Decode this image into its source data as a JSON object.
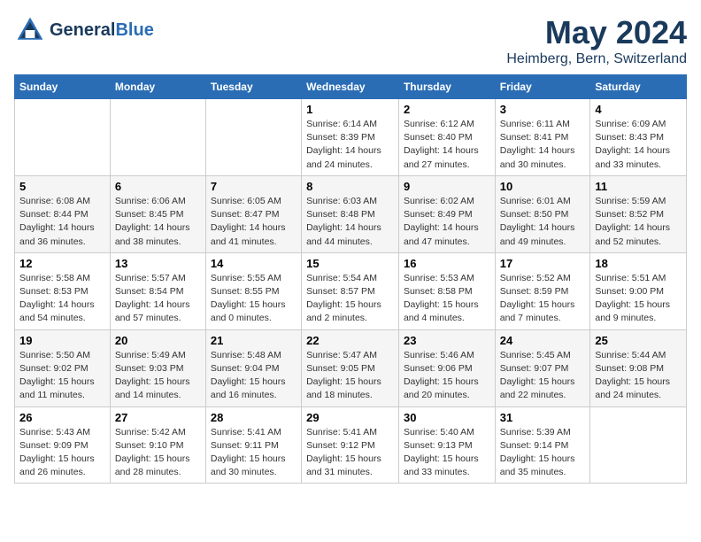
{
  "header": {
    "logo_line1": "General",
    "logo_line2": "Blue",
    "month": "May 2024",
    "location": "Heimberg, Bern, Switzerland"
  },
  "weekdays": [
    "Sunday",
    "Monday",
    "Tuesday",
    "Wednesday",
    "Thursday",
    "Friday",
    "Saturday"
  ],
  "weeks": [
    [
      {
        "day": "",
        "info": ""
      },
      {
        "day": "",
        "info": ""
      },
      {
        "day": "",
        "info": ""
      },
      {
        "day": "1",
        "info": "Sunrise: 6:14 AM\nSunset: 8:39 PM\nDaylight: 14 hours\nand 24 minutes."
      },
      {
        "day": "2",
        "info": "Sunrise: 6:12 AM\nSunset: 8:40 PM\nDaylight: 14 hours\nand 27 minutes."
      },
      {
        "day": "3",
        "info": "Sunrise: 6:11 AM\nSunset: 8:41 PM\nDaylight: 14 hours\nand 30 minutes."
      },
      {
        "day": "4",
        "info": "Sunrise: 6:09 AM\nSunset: 8:43 PM\nDaylight: 14 hours\nand 33 minutes."
      }
    ],
    [
      {
        "day": "5",
        "info": "Sunrise: 6:08 AM\nSunset: 8:44 PM\nDaylight: 14 hours\nand 36 minutes."
      },
      {
        "day": "6",
        "info": "Sunrise: 6:06 AM\nSunset: 8:45 PM\nDaylight: 14 hours\nand 38 minutes."
      },
      {
        "day": "7",
        "info": "Sunrise: 6:05 AM\nSunset: 8:47 PM\nDaylight: 14 hours\nand 41 minutes."
      },
      {
        "day": "8",
        "info": "Sunrise: 6:03 AM\nSunset: 8:48 PM\nDaylight: 14 hours\nand 44 minutes."
      },
      {
        "day": "9",
        "info": "Sunrise: 6:02 AM\nSunset: 8:49 PM\nDaylight: 14 hours\nand 47 minutes."
      },
      {
        "day": "10",
        "info": "Sunrise: 6:01 AM\nSunset: 8:50 PM\nDaylight: 14 hours\nand 49 minutes."
      },
      {
        "day": "11",
        "info": "Sunrise: 5:59 AM\nSunset: 8:52 PM\nDaylight: 14 hours\nand 52 minutes."
      }
    ],
    [
      {
        "day": "12",
        "info": "Sunrise: 5:58 AM\nSunset: 8:53 PM\nDaylight: 14 hours\nand 54 minutes."
      },
      {
        "day": "13",
        "info": "Sunrise: 5:57 AM\nSunset: 8:54 PM\nDaylight: 14 hours\nand 57 minutes."
      },
      {
        "day": "14",
        "info": "Sunrise: 5:55 AM\nSunset: 8:55 PM\nDaylight: 15 hours\nand 0 minutes."
      },
      {
        "day": "15",
        "info": "Sunrise: 5:54 AM\nSunset: 8:57 PM\nDaylight: 15 hours\nand 2 minutes."
      },
      {
        "day": "16",
        "info": "Sunrise: 5:53 AM\nSunset: 8:58 PM\nDaylight: 15 hours\nand 4 minutes."
      },
      {
        "day": "17",
        "info": "Sunrise: 5:52 AM\nSunset: 8:59 PM\nDaylight: 15 hours\nand 7 minutes."
      },
      {
        "day": "18",
        "info": "Sunrise: 5:51 AM\nSunset: 9:00 PM\nDaylight: 15 hours\nand 9 minutes."
      }
    ],
    [
      {
        "day": "19",
        "info": "Sunrise: 5:50 AM\nSunset: 9:02 PM\nDaylight: 15 hours\nand 11 minutes."
      },
      {
        "day": "20",
        "info": "Sunrise: 5:49 AM\nSunset: 9:03 PM\nDaylight: 15 hours\nand 14 minutes."
      },
      {
        "day": "21",
        "info": "Sunrise: 5:48 AM\nSunset: 9:04 PM\nDaylight: 15 hours\nand 16 minutes."
      },
      {
        "day": "22",
        "info": "Sunrise: 5:47 AM\nSunset: 9:05 PM\nDaylight: 15 hours\nand 18 minutes."
      },
      {
        "day": "23",
        "info": "Sunrise: 5:46 AM\nSunset: 9:06 PM\nDaylight: 15 hours\nand 20 minutes."
      },
      {
        "day": "24",
        "info": "Sunrise: 5:45 AM\nSunset: 9:07 PM\nDaylight: 15 hours\nand 22 minutes."
      },
      {
        "day": "25",
        "info": "Sunrise: 5:44 AM\nSunset: 9:08 PM\nDaylight: 15 hours\nand 24 minutes."
      }
    ],
    [
      {
        "day": "26",
        "info": "Sunrise: 5:43 AM\nSunset: 9:09 PM\nDaylight: 15 hours\nand 26 minutes."
      },
      {
        "day": "27",
        "info": "Sunrise: 5:42 AM\nSunset: 9:10 PM\nDaylight: 15 hours\nand 28 minutes."
      },
      {
        "day": "28",
        "info": "Sunrise: 5:41 AM\nSunset: 9:11 PM\nDaylight: 15 hours\nand 30 minutes."
      },
      {
        "day": "29",
        "info": "Sunrise: 5:41 AM\nSunset: 9:12 PM\nDaylight: 15 hours\nand 31 minutes."
      },
      {
        "day": "30",
        "info": "Sunrise: 5:40 AM\nSunset: 9:13 PM\nDaylight: 15 hours\nand 33 minutes."
      },
      {
        "day": "31",
        "info": "Sunrise: 5:39 AM\nSunset: 9:14 PM\nDaylight: 15 hours\nand 35 minutes."
      },
      {
        "day": "",
        "info": ""
      }
    ]
  ]
}
